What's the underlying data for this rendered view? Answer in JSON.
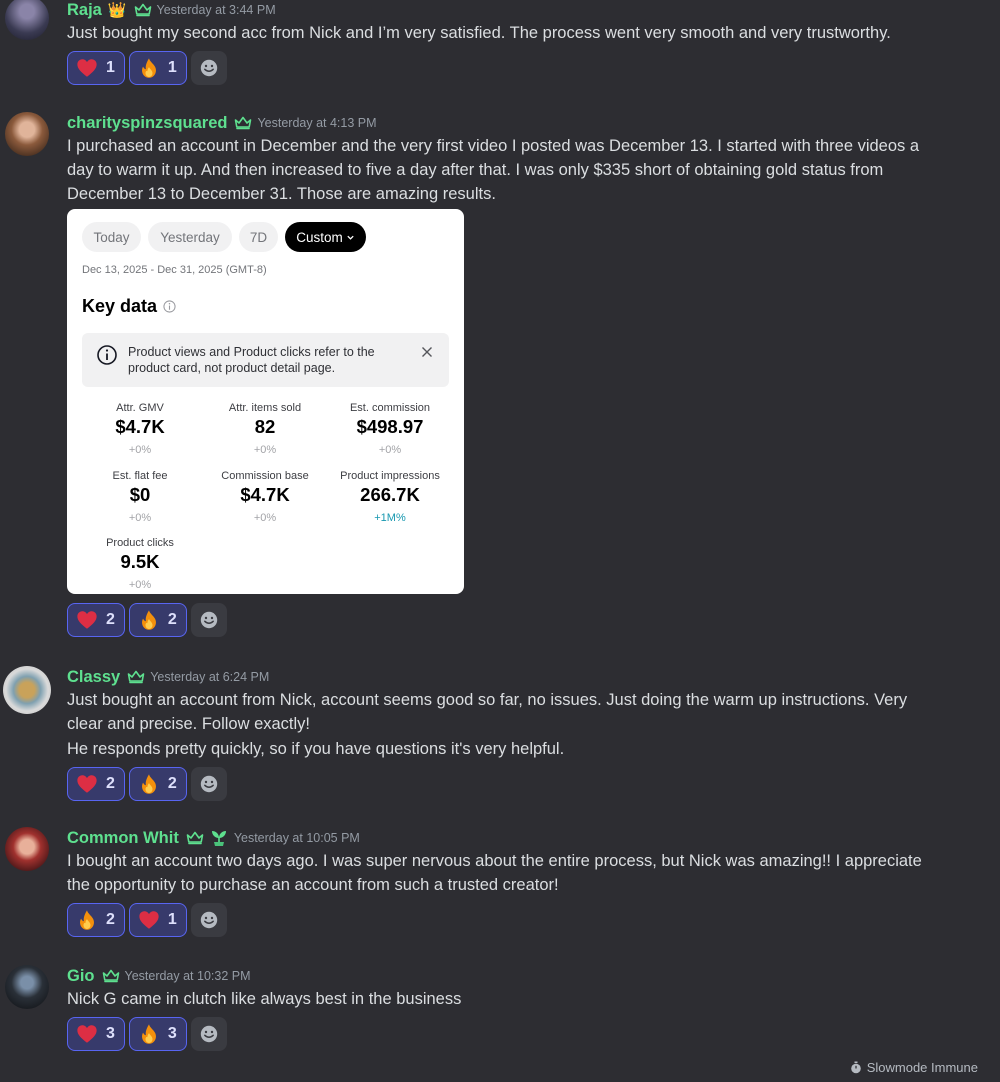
{
  "messages": [
    {
      "author": "Raja",
      "timestamp": "Yesterday at 3:44 PM",
      "text": "Just bought my second acc from Nick and I’m very satisfied. The process went very smooth and very trustworthy.",
      "reactions": [
        {
          "emoji": "heart",
          "count": "1"
        },
        {
          "emoji": "fire",
          "count": "1"
        }
      ]
    },
    {
      "author": "charityspinzsquared",
      "timestamp": "Yesterday at 4:13 PM",
      "text_lines": [
        "I purchased an account in December and the very first video I posted was December 13. I started with three videos a",
        "day to warm it up. And then increased to five a day after that. I was only $335 short of obtaining gold status from",
        "December 13 to December 31. Those are amazing results."
      ],
      "reactions": [
        {
          "emoji": "heart",
          "count": "2"
        },
        {
          "emoji": "fire",
          "count": "2"
        }
      ]
    },
    {
      "author": "Classy",
      "timestamp": "Yesterday at 6:24 PM",
      "text_lines": [
        "Just bought an account from Nick, account seems good so far, no issues. Just doing the warm up instructions. Very",
        "clear and precise. Follow exactly!",
        "He responds pretty quickly, so if you have questions it's very helpful."
      ],
      "reactions": [
        {
          "emoji": "heart",
          "count": "2"
        },
        {
          "emoji": "fire",
          "count": "2"
        }
      ]
    },
    {
      "author": "Common Whit",
      "timestamp": "Yesterday at 10:05 PM",
      "text_lines": [
        "I bought an account two days ago. I was super nervous about the entire process, but Nick was amazing!! I appreciate",
        "the opportunity to purchase an account from such a trusted creator!"
      ],
      "reactions": [
        {
          "emoji": "fire",
          "count": "2"
        },
        {
          "emoji": "heart",
          "count": "1"
        }
      ]
    },
    {
      "author": "Gio",
      "timestamp": "Yesterday at 10:32 PM",
      "text": "Nick G came in clutch like always best in the business",
      "reactions": [
        {
          "emoji": "heart",
          "count": "3"
        },
        {
          "emoji": "fire",
          "count": "3"
        }
      ]
    }
  ],
  "embed": {
    "tabs": [
      "Today",
      "Yesterday",
      "7D",
      "Custom"
    ],
    "active_tab": "Custom",
    "date_range": "Dec 13, 2025 - Dec 31, 2025 (GMT-8)",
    "title": "Key data",
    "notice": "Product views and Product clicks refer to the product card, not product detail page.",
    "metrics": [
      {
        "label": "Attr. GMV",
        "value": "$4.7K",
        "change": "+0%"
      },
      {
        "label": "Attr. items sold",
        "value": "82",
        "change": "+0%"
      },
      {
        "label": "Est. commission",
        "value": "$498.97",
        "change": "+0%"
      },
      {
        "label": "Est. flat fee",
        "value": "$0",
        "change": "+0%"
      },
      {
        "label": "Commission base",
        "value": "$4.7K",
        "change": "+0%"
      },
      {
        "label": "Product impressions",
        "value": "266.7K",
        "change": "+1M%"
      },
      {
        "label": "Product clicks",
        "value": "9.5K",
        "change": "+0%"
      }
    ]
  },
  "footer": {
    "slowmode": "Slowmode Immune"
  },
  "colors": {
    "author": "#5ee08f",
    "reaction_bg": "#373a6b",
    "reaction_border": "#5865f2",
    "background": "#2d2d32"
  },
  "icons": [
    "crown-icon",
    "heart-emoji-icon",
    "fire-emoji-icon",
    "add-reaction-icon",
    "info-icon",
    "close-icon",
    "stopwatch-icon"
  ]
}
